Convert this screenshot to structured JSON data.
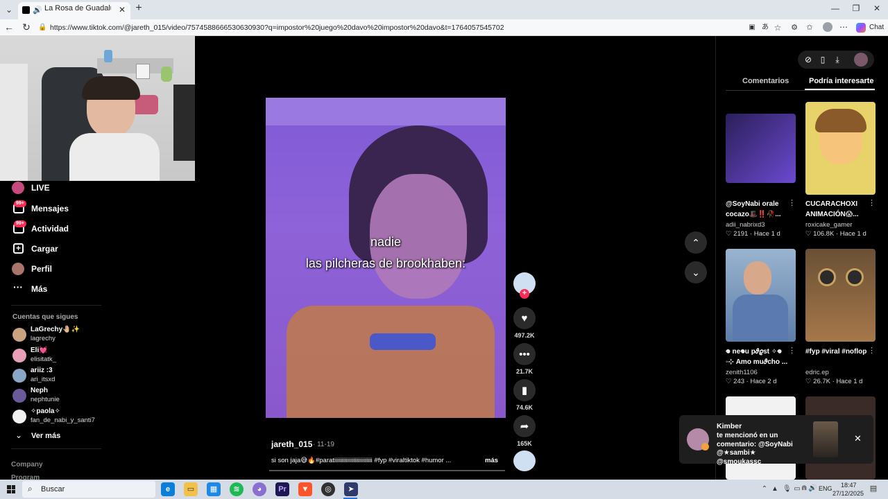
{
  "browser": {
    "tab_title": "La Rosa de Guadalupe: Humo",
    "url": "https://www.tiktok.com/@jareth_015/video/7574588666530630930?q=impostor%20juego%20davo%20impostor%20davo&t=1764057545702",
    "chat_label": "Chat"
  },
  "sidebar": {
    "items": [
      {
        "label": "LIVE",
        "badge": ""
      },
      {
        "label": "Mensajes",
        "badge": "99+"
      },
      {
        "label": "Actividad",
        "badge": "99+"
      },
      {
        "label": "Cargar",
        "badge": ""
      },
      {
        "label": "Perfil",
        "badge": ""
      },
      {
        "label": "Más",
        "badge": ""
      }
    ],
    "following_title": "Cuentas que sigues",
    "following": [
      {
        "name": "LaGrechy🤚🏼✨",
        "handle": "lagrechy",
        "color": "#c9a27f"
      },
      {
        "name": "Eli💓",
        "handle": "elisitatk_",
        "color": "#e8a0b8"
      },
      {
        "name": "ariiz :3",
        "handle": "ari_itsxd",
        "color": "#8aa7c7"
      },
      {
        "name": "Neph",
        "handle": "nephtunie",
        "color": "#6a5a9a"
      },
      {
        "name": "✧paola✧",
        "handle": "fan_de_nabi_y_santi7",
        "color": "#f0f0f0"
      }
    ],
    "see_more": "Ver más",
    "company": "Company",
    "program": "Program"
  },
  "video": {
    "caption_line1": "nadie",
    "caption_line2": "las pilcheras de brookhaben:",
    "author": "jareth_015",
    "date": "· 11-19",
    "description": "si son jaja😅🔥#paratiiiiiiiiiiiiiiiiiiiiiiiiii #fyp #viraltiktok #humor ...",
    "more": "más",
    "likes": "497.2K",
    "comments": "21.7K",
    "saves": "74.6K",
    "shares": "165K"
  },
  "right_panel": {
    "tabs": [
      "Comentarios",
      "Podría interesarte"
    ],
    "active_tab": 1,
    "cards": [
      {
        "title": "@SoyNabi orale cocazo🎩‼️🥀...",
        "user": "adii_nabrixd3",
        "likes": "2191",
        "time": "· Hace 1 d"
      },
      {
        "title": "CUCARACHOXI ANIMACIÓN😱...",
        "user": "roxicake_gamer",
        "likes": "106.8K",
        "time": "· Hace 1 d"
      },
      {
        "title": "𖦹 ne𖦹u p𝜗𝜚st ✧𖦹 ◦⊹ Amo mu𝜗cho ...",
        "user": "zenith1106",
        "likes": "243",
        "time": "· Hace 2 d"
      },
      {
        "title": "#fyp #viral #noflop",
        "user": "edric.ep",
        "likes": "26.7K",
        "time": "· Hace 1 d"
      }
    ]
  },
  "notification": {
    "name": "Kimber",
    "text": "te mencionó en un comentario: @SoyNabi @★sambi★ @smoukassc"
  },
  "taskbar": {
    "search_placeholder": "Buscar",
    "lang": "ENG",
    "time": "18:47",
    "date": "27/12/2025"
  },
  "colors": {
    "accent": "#fe2c55",
    "video_bg": "#8a5cd6"
  }
}
